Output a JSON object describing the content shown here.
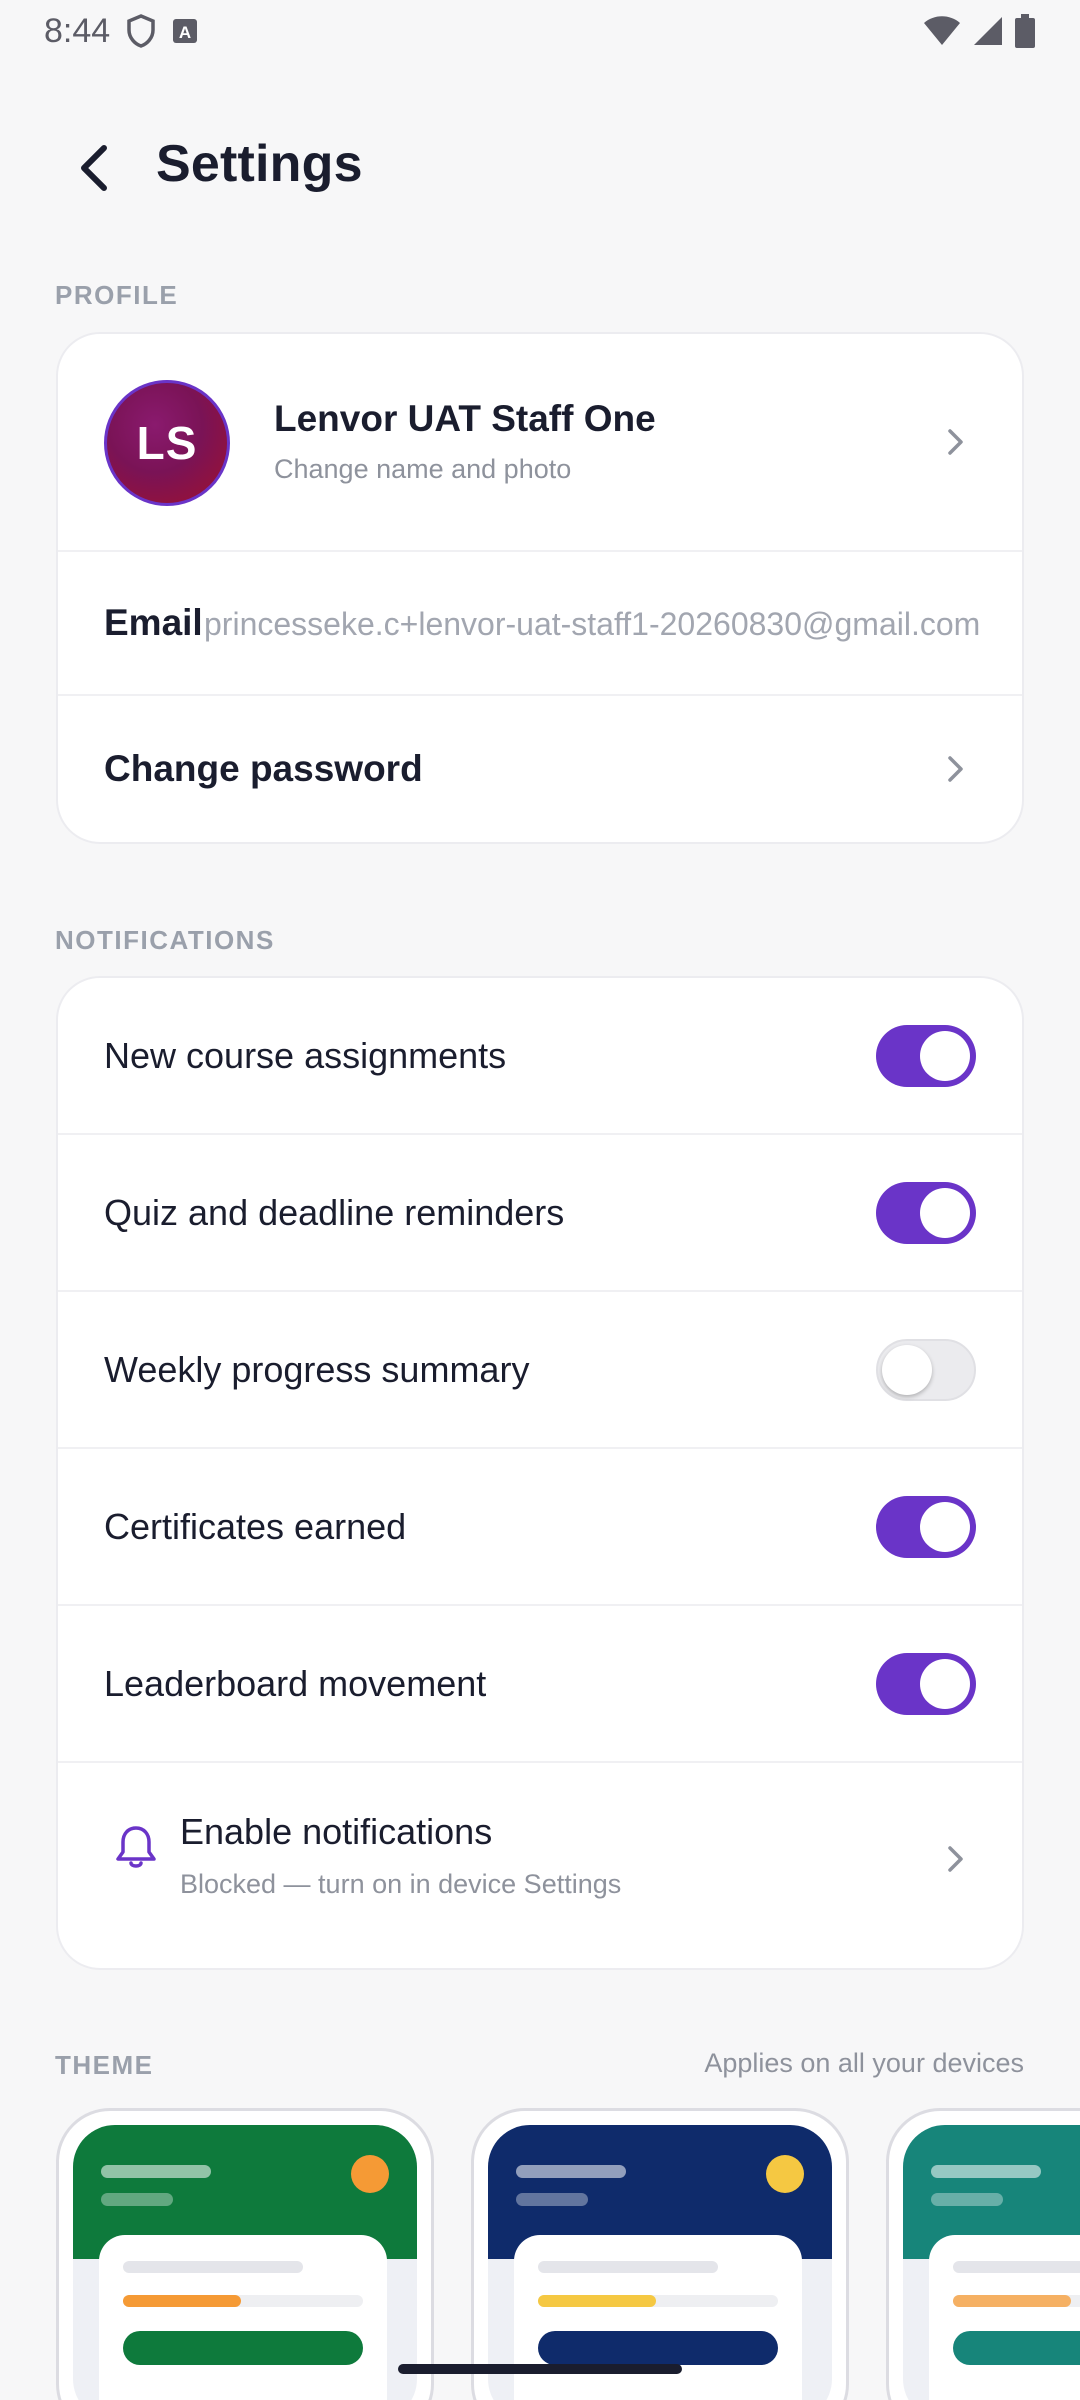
{
  "status_bar": {
    "time": "8:44"
  },
  "app_bar": {
    "title": "Settings"
  },
  "profile_section": {
    "header": "PROFILE",
    "avatar_initials": "LS",
    "name": "Lenvor UAT Staff One",
    "subtitle": "Change name and photo",
    "email_label": "Email",
    "email_value": "princesseke.c+lenvor-uat-staff1-20260830@gmail.com",
    "change_password_label": "Change password"
  },
  "notifications_section": {
    "header": "NOTIFICATIONS",
    "items": [
      {
        "label": "New course assignments",
        "enabled": true
      },
      {
        "label": "Quiz and deadline reminders",
        "enabled": true
      },
      {
        "label": "Weekly progress summary",
        "enabled": false
      },
      {
        "label": "Certificates earned",
        "enabled": true
      },
      {
        "label": "Leaderboard movement",
        "enabled": true
      }
    ],
    "enable": {
      "title": "Enable notifications",
      "subtitle": "Blocked — turn on in device Settings"
    }
  },
  "theme_section": {
    "header": "THEME",
    "aside": "Applies on all your devices",
    "themes": [
      {
        "top": "#0e7a3c",
        "accent": "#f59a35",
        "button": "#0e7a3c"
      },
      {
        "top": "#0f2b6b",
        "accent": "#f5c842",
        "button": "#0f2b6b"
      },
      {
        "top": "#17857a",
        "accent": "#f5b063",
        "button": "#17857a"
      }
    ]
  },
  "colors": {
    "accent": "#6a34c8",
    "background": "#f7f7f8",
    "text_primary": "#1a1d2e",
    "text_secondary": "#8e929c"
  }
}
